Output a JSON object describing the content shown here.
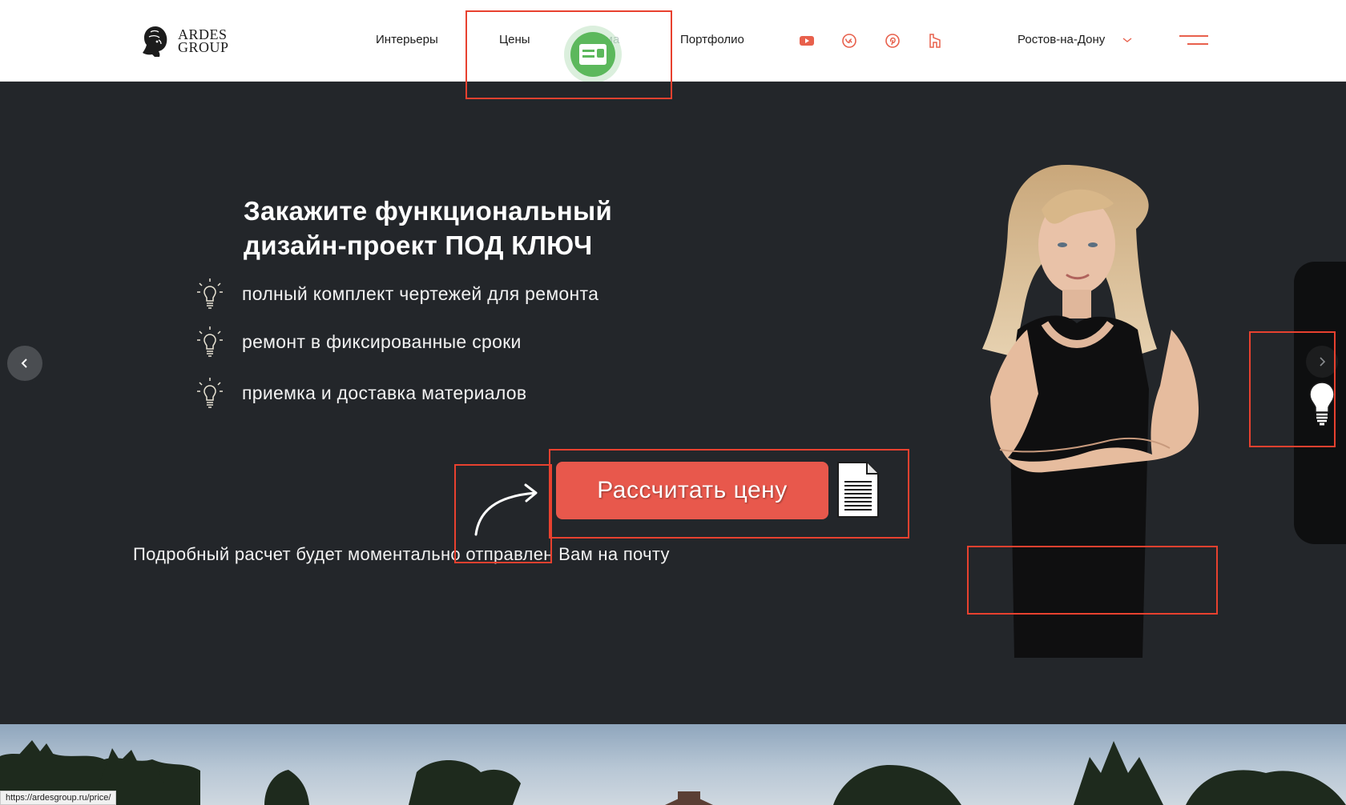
{
  "header": {
    "logo": {
      "line1": "ARDES",
      "line2": "GROUP"
    },
    "nav": [
      {
        "label": "Интерьеры"
      },
      {
        "label": "Цены"
      },
      {
        "label": "Дома"
      },
      {
        "label": "Портфолио"
      }
    ],
    "social_icons": [
      "youtube-icon",
      "vk-icon",
      "pinterest-icon",
      "houzz-icon"
    ],
    "city": "Ростов-на-Дону"
  },
  "hero": {
    "title_line1": "Закажите функциональный",
    "title_line2": "дизайн-проект ПОД КЛЮЧ",
    "features": [
      {
        "text": "полный комплект чертежей для ремонта"
      },
      {
        "text": "ремонт в фиксированные сроки"
      },
      {
        "text": "приемка и доставка материалов"
      }
    ],
    "cta_label": "Рассчитать цену",
    "note": "Подробный расчет будет моментально отправлен Вам на почту"
  },
  "status_bar": {
    "url": "https://ardesgroup.ru/price/"
  },
  "colors": {
    "accent": "#e8584c",
    "hero_bg": "#23262a",
    "annotation": "#e8412f",
    "badge_green": "#5cb85c"
  }
}
